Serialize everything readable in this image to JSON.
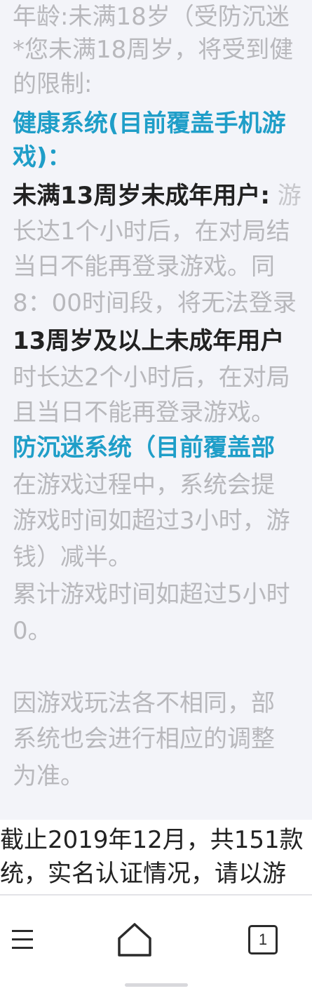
{
  "content": {
    "age_line": "年龄:未满18岁（受防沉迷",
    "notice_line1": "*您未满18周岁，将受到健",
    "notice_line2": "的限制:",
    "health_title_line1": "健康系统(目前覆盖手机游",
    "health_title_line2": "戏)：",
    "under13_heading": "未满13周岁未成年用户:",
    "under13_tail": "游",
    "under13_line1": "长达1个小时后，在对局结",
    "under13_line2": "当日不能再登录游戏。同",
    "under13_line3": "8：00时间段，将无法登录",
    "over13_heading": "13周岁及以上未成年用户",
    "over13_line1": "时长达2个小时后，在对局",
    "over13_line2": "且当日不能再登录游戏。",
    "anti_title": "防沉迷系统（目前覆盖部",
    "anti_line1": "在游戏过程中，系统会提",
    "anti_line2": "游戏时间如超过3小时，游",
    "anti_line3": "钱）减半。",
    "anti_line4": "累计游戏时间如超过5小时",
    "anti_line5": "0。",
    "note_line1": "因游戏玩法各不相同，部",
    "note_line2": "系统也会进行相应的调整",
    "note_line3": "为准。"
  },
  "footer": {
    "line1": "截止2019年12月，共151款",
    "line2": "统，实名认证情况，请以游"
  },
  "bottom_nav": {
    "menu_icon": "menu-icon",
    "home_icon": "home-icon",
    "tab_count": "1"
  },
  "colors": {
    "gray_text": "#b8b8bc",
    "dark_text": "#222222",
    "accent_blue": "#1f9ec8",
    "panel_bg": "#f3f4f9"
  }
}
